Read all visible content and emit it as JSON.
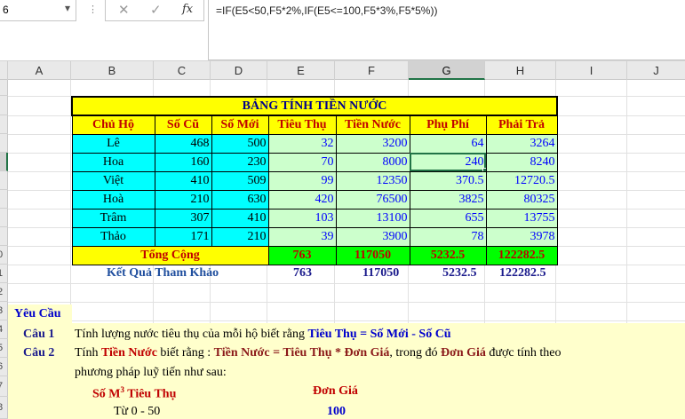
{
  "formula_bar": {
    "name_box": "6",
    "name_box_chevron": "▾",
    "dots": "⋮",
    "cancel_icon": "✕",
    "enter_icon": "✓",
    "fx_label": "fx",
    "formula": "=IF(E5<50,F5*2%,IF(E5<=100,F5*3%,F5*5%))"
  },
  "columns": [
    "A",
    "B",
    "C",
    "D",
    "E",
    "F",
    "G",
    "H",
    "I",
    "J"
  ],
  "selected_column": "G",
  "row_numbers": [
    "",
    "",
    "",
    "",
    "",
    "",
    "",
    "",
    "",
    "0",
    "1",
    "2",
    "3",
    "4",
    "5",
    "6",
    "7",
    "8"
  ],
  "table": {
    "title": "BẢNG TÍNH TIỀN NƯỚC",
    "headers": [
      "Chủ Hộ",
      "Số Cũ",
      "Số Mới",
      "Tiêu Thụ",
      "Tiền Nước",
      "Phụ Phí",
      "Phải Trả"
    ],
    "rows": [
      {
        "name": "Lê",
        "old": "468",
        "new": "500",
        "use": "32",
        "water": "3200",
        "fee": "64",
        "pay": "3264"
      },
      {
        "name": "Hoa",
        "old": "160",
        "new": "230",
        "use": "70",
        "water": "8000",
        "fee": "240",
        "pay": "8240"
      },
      {
        "name": "Việt",
        "old": "410",
        "new": "509",
        "use": "99",
        "water": "12350",
        "fee": "370.5",
        "pay": "12720.5"
      },
      {
        "name": "Hoà",
        "old": "210",
        "new": "630",
        "use": "420",
        "water": "76500",
        "fee": "3825",
        "pay": "80325"
      },
      {
        "name": "Trâm",
        "old": "307",
        "new": "410",
        "use": "103",
        "water": "13100",
        "fee": "655",
        "pay": "13755"
      },
      {
        "name": "Thảo",
        "old": "171",
        "new": "210",
        "use": "39",
        "water": "3900",
        "fee": "78",
        "pay": "3978"
      }
    ],
    "total_label": "Tổng Cộng",
    "totals": {
      "use": "763",
      "water": "117050",
      "fee": "5232.5",
      "pay": "122282.5"
    }
  },
  "reference": {
    "label": "Kết Quả Tham Khảo",
    "use": "763",
    "water": "117050",
    "fee": "5232.5",
    "pay": "122282.5"
  },
  "requirements": {
    "heading": "Yêu Cầu",
    "q1_label": "Câu 1",
    "q1_text": "Tính lượng nước tiêu thụ của mỗi hộ biết rằng ",
    "q1_formula": "Tiêu Thụ = Số Mới - Số Cũ",
    "q2_label": "Câu 2",
    "q2_pre": "Tính ",
    "q2_term": "Tiền Nước",
    "q2_mid": " biết rằng : ",
    "q2_formula": "Tiền Nước = Tiêu Thụ * Đơn Giá",
    "q2_mid2": ", trong đó ",
    "q2_term2": "Đơn Giá",
    "q2_post": " được tính theo",
    "q2_line2": "phương pháp luỹ tiến như sau:",
    "col_use_pre": "Số  M",
    "col_use_sup": "3",
    "col_use_post": " Tiêu Thụ",
    "col_price": "Đơn Giá",
    "tier1_range": "Từ 0 - 50",
    "tier1_price": "100"
  }
}
